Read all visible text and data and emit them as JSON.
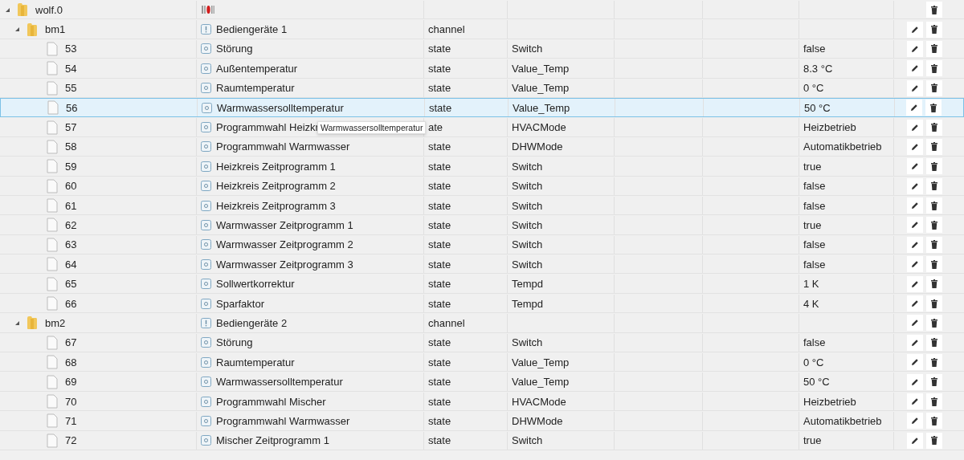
{
  "tree": [
    {
      "label": "wolf.0",
      "kind": "instance",
      "expanded": true,
      "selected": false,
      "children": [
        {
          "label": "bm1",
          "kind": "channel",
          "expanded": true,
          "selected": false,
          "name": "Bediengeräte 1",
          "type": "channel",
          "children": [
            {
              "label": "53",
              "kind": "state",
              "selected": false,
              "name": "Störung",
              "type": "state",
              "role": "Switch",
              "value": "false"
            },
            {
              "label": "54",
              "kind": "state",
              "selected": false,
              "name": "Außentemperatur",
              "type": "state",
              "role": "Value_Temp",
              "value": "8.3 °C"
            },
            {
              "label": "55",
              "kind": "state",
              "selected": false,
              "name": "Raumtemperatur",
              "type": "state",
              "role": "Value_Temp",
              "value": "0 °C"
            },
            {
              "label": "56",
              "kind": "state",
              "selected": true,
              "name": "Warmwassersolltemperatur",
              "type": "state",
              "role": "Value_Temp",
              "value": "50 °C"
            },
            {
              "label": "57",
              "kind": "state",
              "selected": false,
              "name": "Programmwahl Heizkr",
              "type": "ate",
              "role": "HVACMode",
              "value": "Heizbetrieb"
            },
            {
              "label": "58",
              "kind": "state",
              "selected": false,
              "name": "Programmwahl Warmwasser",
              "type": "state",
              "role": "DHWMode",
              "value": "Automatikbetrieb"
            },
            {
              "label": "59",
              "kind": "state",
              "selected": false,
              "name": "Heizkreis Zeitprogramm 1",
              "type": "state",
              "role": "Switch",
              "value": "true"
            },
            {
              "label": "60",
              "kind": "state",
              "selected": false,
              "name": "Heizkreis Zeitprogramm 2",
              "type": "state",
              "role": "Switch",
              "value": "false"
            },
            {
              "label": "61",
              "kind": "state",
              "selected": false,
              "name": "Heizkreis Zeitprogramm 3",
              "type": "state",
              "role": "Switch",
              "value": "false"
            },
            {
              "label": "62",
              "kind": "state",
              "selected": false,
              "name": "Warmwasser Zeitprogramm 1",
              "type": "state",
              "role": "Switch",
              "value": "true"
            },
            {
              "label": "63",
              "kind": "state",
              "selected": false,
              "name": "Warmwasser Zeitprogramm 2",
              "type": "state",
              "role": "Switch",
              "value": "false"
            },
            {
              "label": "64",
              "kind": "state",
              "selected": false,
              "name": "Warmwasser Zeitprogramm 3",
              "type": "state",
              "role": "Switch",
              "value": "false"
            },
            {
              "label": "65",
              "kind": "state",
              "selected": false,
              "name": "Sollwertkorrektur",
              "type": "state",
              "role": "Tempd",
              "value": "1 K"
            },
            {
              "label": "66",
              "kind": "state",
              "selected": false,
              "name": "Sparfaktor",
              "type": "state",
              "role": "Tempd",
              "value": "4 K"
            }
          ]
        },
        {
          "label": "bm2",
          "kind": "channel",
          "expanded": true,
          "selected": false,
          "name": "Bediengeräte 2",
          "type": "channel",
          "children": [
            {
              "label": "67",
              "kind": "state",
              "selected": false,
              "name": "Störung",
              "type": "state",
              "role": "Switch",
              "value": "false"
            },
            {
              "label": "68",
              "kind": "state",
              "selected": false,
              "name": "Raumtemperatur",
              "type": "state",
              "role": "Value_Temp",
              "value": "0 °C"
            },
            {
              "label": "69",
              "kind": "state",
              "selected": false,
              "name": "Warmwassersolltemperatur",
              "type": "state",
              "role": "Value_Temp",
              "value": "50 °C"
            },
            {
              "label": "70",
              "kind": "state",
              "selected": false,
              "name": "Programmwahl Mischer",
              "type": "state",
              "role": "HVACMode",
              "value": "Heizbetrieb"
            },
            {
              "label": "71",
              "kind": "state",
              "selected": false,
              "name": "Programmwahl Warmwasser",
              "type": "state",
              "role": "DHWMode",
              "value": "Automatikbetrieb"
            },
            {
              "label": "72",
              "kind": "state",
              "selected": false,
              "name": "Mischer Zeitprogramm 1",
              "type": "state",
              "role": "Switch",
              "value": "true"
            }
          ]
        }
      ]
    }
  ],
  "tooltip": {
    "text": "Warmwassersolltemperatur"
  }
}
